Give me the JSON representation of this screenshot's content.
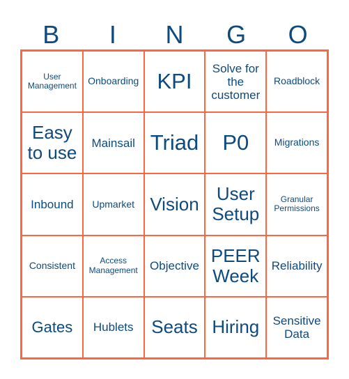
{
  "header": [
    "B",
    "I",
    "N",
    "G",
    "O"
  ],
  "cells": [
    {
      "text": "User Management",
      "size": 1
    },
    {
      "text": "Onboarding",
      "size": 2
    },
    {
      "text": "KPI",
      "size": 6
    },
    {
      "text": "Solve for the customer",
      "size": 3
    },
    {
      "text": "Roadblock",
      "size": 2
    },
    {
      "text": "Easy to use",
      "size": 5
    },
    {
      "text": "Mainsail",
      "size": 3
    },
    {
      "text": "Triad",
      "size": 6
    },
    {
      "text": "P0",
      "size": 6
    },
    {
      "text": "Migrations",
      "size": 2
    },
    {
      "text": "Inbound",
      "size": 3
    },
    {
      "text": "Upmarket",
      "size": 2
    },
    {
      "text": "Vision",
      "size": 5
    },
    {
      "text": "User Setup",
      "size": 5
    },
    {
      "text": "Granular Permissions",
      "size": 1
    },
    {
      "text": "Consistent",
      "size": 2
    },
    {
      "text": "Access Management",
      "size": 1
    },
    {
      "text": "Objective",
      "size": 3
    },
    {
      "text": "PEER Week",
      "size": 5
    },
    {
      "text": "Reliability",
      "size": 3
    },
    {
      "text": "Gates",
      "size": 4
    },
    {
      "text": "Hublets",
      "size": 3
    },
    {
      "text": "Seats",
      "size": 5
    },
    {
      "text": "Hiring",
      "size": 5
    },
    {
      "text": "Sensitive Data",
      "size": 3
    }
  ],
  "colors": {
    "border": "#ff6640",
    "text": "#0e4a7e"
  }
}
